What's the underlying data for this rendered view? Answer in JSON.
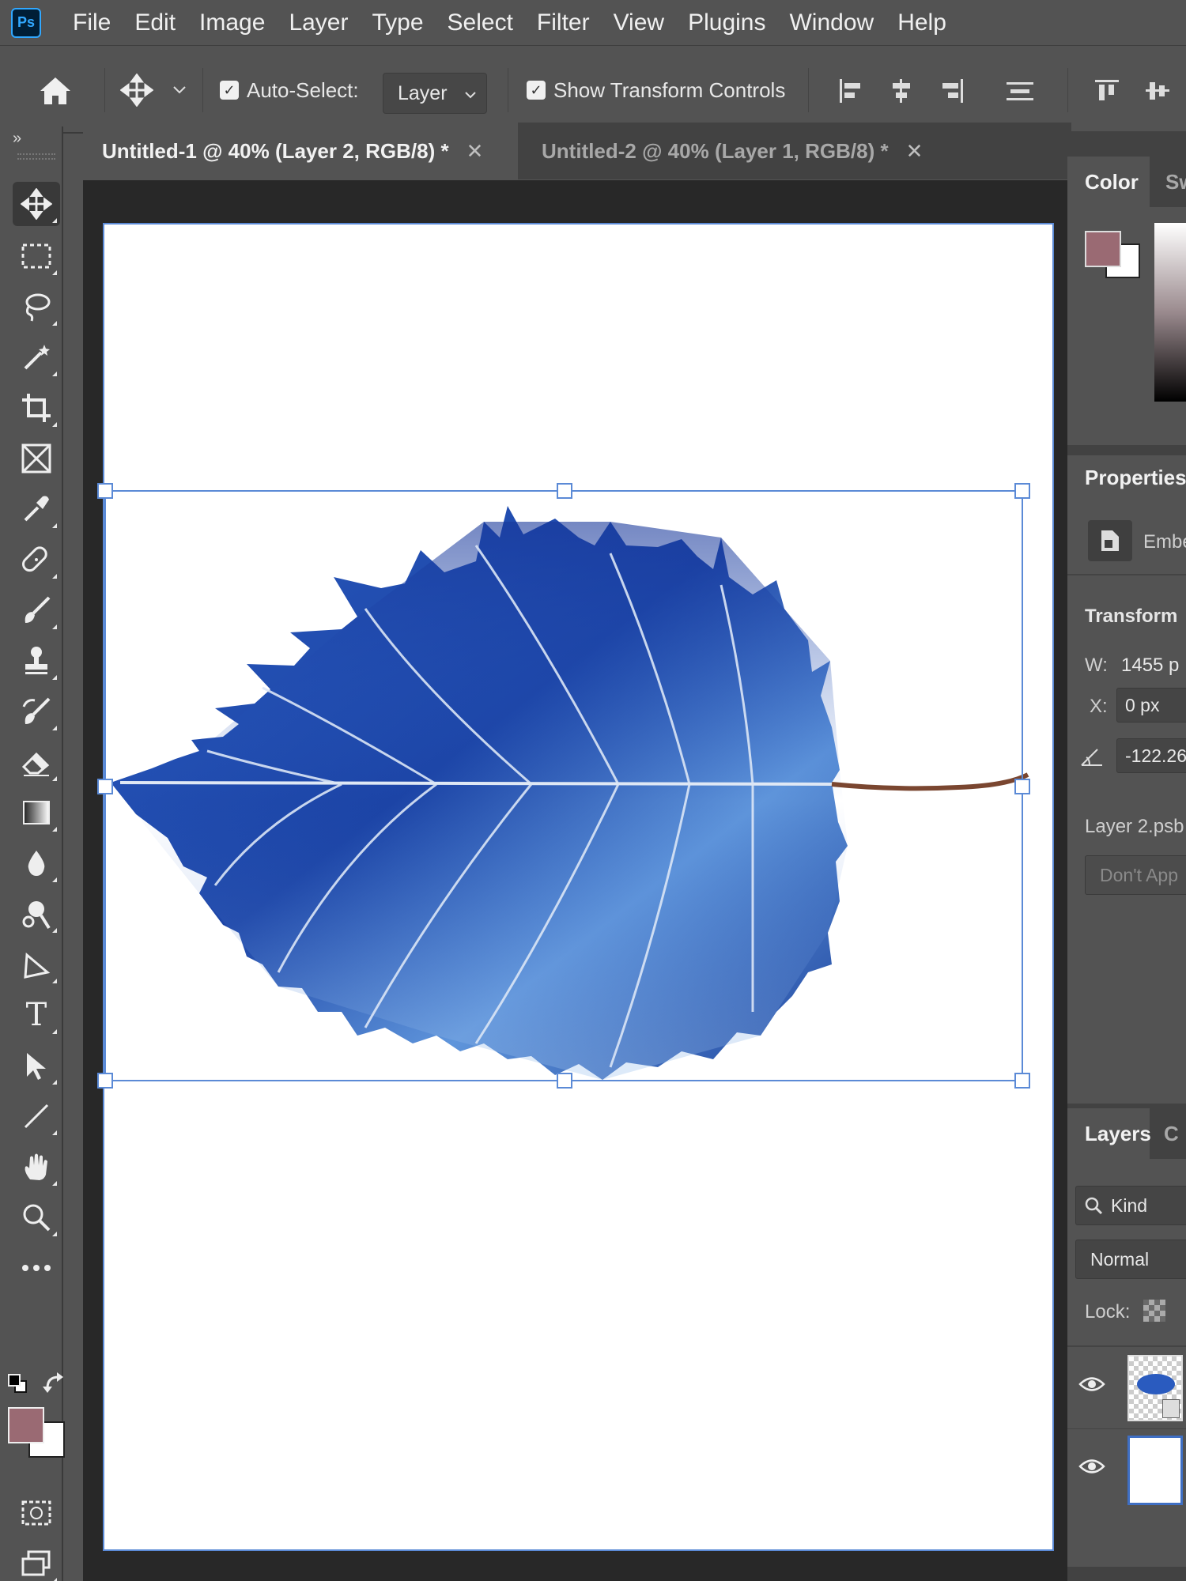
{
  "app": {
    "logo": "Ps"
  },
  "menu": [
    "File",
    "Edit",
    "Image",
    "Layer",
    "Type",
    "Select",
    "Filter",
    "View",
    "Plugins",
    "Window",
    "Help"
  ],
  "options": {
    "auto_select_label": "Auto-Select:",
    "auto_select_checked": true,
    "auto_select_target": "Layer",
    "show_transform_label": "Show Transform Controls",
    "show_transform_checked": true
  },
  "tabs": [
    {
      "label": "Untitled-1 @ 40% (Layer 2, RGB/8) *",
      "active": true
    },
    {
      "label": "Untitled-2 @ 40% (Layer 1, RGB/8) *",
      "active": false
    }
  ],
  "tools": [
    "move-tool",
    "rectangular-marquee-tool",
    "lasso-tool",
    "magic-wand-tool",
    "crop-tool",
    "frame-tool",
    "eyedropper-tool",
    "healing-brush-tool",
    "brush-tool",
    "clone-stamp-tool",
    "history-brush-tool",
    "eraser-tool",
    "gradient-tool",
    "blur-tool",
    "dodge-tool",
    "pen-tool",
    "type-tool",
    "path-selection-tool",
    "line-tool",
    "hand-tool",
    "zoom-tool",
    "more-tools"
  ],
  "colors": {
    "foreground": "#9a6a73",
    "background": "#ffffff",
    "leaf_primary": "#1e4fb0",
    "selection": "#5b8ad6"
  },
  "panels": {
    "color": {
      "tabs": [
        "Color",
        "Sw"
      ]
    },
    "properties": {
      "title": "Properties",
      "embed_label": "Embe",
      "transform_title": "Transform",
      "w_label": "W:",
      "w_value": "1455 p",
      "x_label": "X:",
      "x_value": "0 px",
      "angle_value": "-122.26",
      "layer_file": "Layer 2.psb",
      "dont_apply": "Don't App"
    },
    "layers": {
      "tabs": [
        "Layers",
        "C"
      ],
      "kind_label": "Kind",
      "blend_mode": "Normal",
      "lock_label": "Lock:"
    }
  }
}
